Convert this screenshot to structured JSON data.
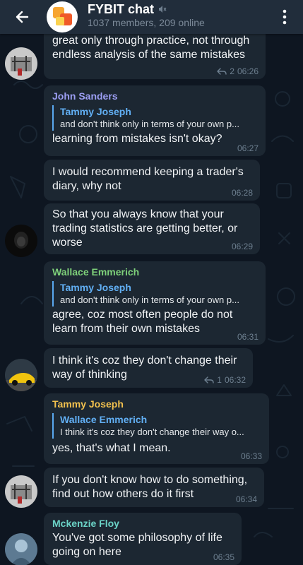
{
  "header": {
    "title": "FYBIT chat",
    "subtitle": "1037 members, 209 online",
    "colors": {
      "background": "#212d3b",
      "title": "#ffffff",
      "subtitle": "#7c8a99"
    },
    "icons": {
      "back": "arrow-left-icon",
      "mute": "muted-speaker-icon",
      "menu": "more-vertical-icon"
    }
  },
  "messages": [
    {
      "text": "great only through practice, not through\nendless analysis of the same mistakes",
      "replies_count": "2",
      "time": "06:26"
    },
    {
      "sender": "John Sanders",
      "sender_color": "#9c9ef3",
      "reply_to": {
        "name": "Tammy Joseph",
        "text": "and don't think only in terms of your own p..."
      },
      "text": "learning from mistakes isn't okay?",
      "time": "06:27"
    },
    {
      "text": "I would recommend keeping a trader's\ndiary, why not",
      "time": "06:28"
    },
    {
      "text": "So that you always know that your\ntrading statistics are getting better, or\nworse",
      "time": "06:29"
    },
    {
      "sender": "Wallace Emmerich",
      "sender_color": "#7ed17a",
      "reply_to": {
        "name": "Tammy Joseph",
        "text": "and don't think only in terms of your own p..."
      },
      "text": "agree, coz most often people do not\nlearn from their own mistakes",
      "time": "06:31"
    },
    {
      "text": "I think it's coz they don't change their\nway of thinking",
      "replies_count": "1",
      "time": "06:32"
    },
    {
      "sender": "Tammy Joseph",
      "sender_color": "#f2c14e",
      "reply_to": {
        "name": "Wallace Emmerich",
        "text": "I think it's coz they don't change their way o..."
      },
      "text": "yes, that's what I mean.",
      "time": "06:33"
    },
    {
      "text": "If you don't know how to do something,\nfind out how others do it first",
      "time": "06:34"
    },
    {
      "sender": "Mckenzie Floy",
      "sender_color": "#6bd3c7",
      "text": "You've got some philosophy of life\ngoing on here",
      "time": "06:35"
    }
  ],
  "theme": {
    "chat_background": "#0e1621",
    "bubble": "#1c2732",
    "reply_bar": "#5aa9f0",
    "meta_text": "#6d7f8f"
  }
}
